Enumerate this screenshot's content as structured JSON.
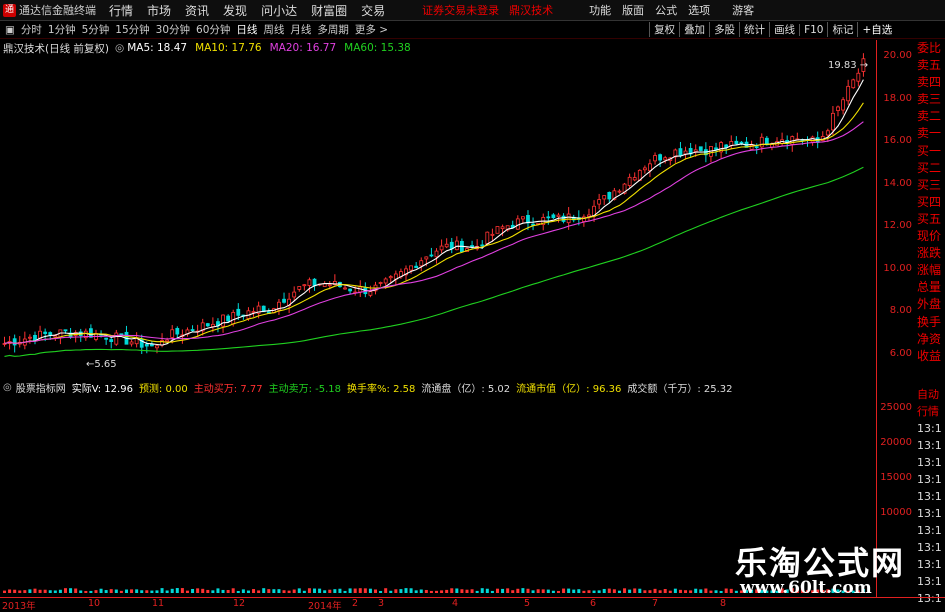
{
  "menubar": {
    "app_title": "通达信金融终端",
    "items": [
      "行情",
      "市场",
      "资讯",
      "发现",
      "问小达",
      "财富圈",
      "交易"
    ],
    "login_status": "证券交易未登录",
    "formula_name": "鼎汉技术",
    "right_items": [
      "功能",
      "版面",
      "公式",
      "选项"
    ],
    "guest": "游客"
  },
  "periods": [
    "分时",
    "1分钟",
    "5分钟",
    "15分钟",
    "30分钟",
    "60分钟",
    "日线",
    "周线",
    "月线",
    "多周期",
    "更多 >"
  ],
  "active_period": "日线",
  "tools": [
    "复权",
    "叠加",
    "多股",
    "统计",
    "画线",
    "F10",
    "标记",
    "+自选"
  ],
  "chart": {
    "title": "鼎汉技术(日线 前复权)",
    "ma": [
      {
        "label": "MA5: 18.47",
        "color": "#ffffff"
      },
      {
        "label": "MA10: 17.76",
        "color": "#f0e000"
      },
      {
        "label": "MA20: 16.77",
        "color": "#e040e0"
      },
      {
        "label": "MA60: 15.38",
        "color": "#20d020"
      }
    ],
    "high_label": "19.83",
    "low_label": "5.65"
  },
  "price_axis": [
    "20.00",
    "18.00",
    "16.00",
    "14.00",
    "12.00",
    "10.00",
    "8.00",
    "6.00"
  ],
  "vol_row": {
    "title": "股票指标网",
    "fields": [
      {
        "label": "实际V:",
        "value": "12.96",
        "color": "#ffffff"
      },
      {
        "label": "预测:",
        "value": "0.00",
        "color": "#f0e000"
      },
      {
        "label": "主动买万:",
        "value": "7.77",
        "color": "#ff3030"
      },
      {
        "label": "主动卖万:",
        "value": "-5.18",
        "color": "#20d020"
      },
      {
        "label": "换手率%:",
        "value": "2.58",
        "color": "#f0e000"
      },
      {
        "label": "流通盘（亿）:",
        "value": "5.02",
        "color": "#dddddd"
      },
      {
        "label": "流通市值（亿）:",
        "value": "96.36",
        "color": "#f0e000"
      },
      {
        "label": "成交额（千万）:",
        "value": "25.32",
        "color": "#dddddd"
      }
    ]
  },
  "vol_axis": [
    "25000",
    "20000",
    "15000",
    "10000"
  ],
  "side_labels": [
    "委比",
    "卖五",
    "卖四",
    "卖三",
    "卖二",
    "卖一",
    "买一",
    "买二",
    "买三",
    "买四",
    "买五",
    "现价",
    "涨跌",
    "涨幅",
    "总量",
    "外盘",
    "换手",
    "净资",
    "收益"
  ],
  "side_labels2": [
    "自动",
    "行情",
    "13:1",
    "13:1",
    "13:1",
    "13:1",
    "13:1",
    "13:1",
    "13:1",
    "13:1",
    "13:1",
    "13:1",
    "13:1"
  ],
  "date_axis": [
    "2013年",
    "10",
    "11",
    "12",
    "2014年",
    "2",
    "3",
    "4",
    "5",
    "6",
    "7",
    "8"
  ],
  "watermark": {
    "cn": "乐淘公式网",
    "url": "www.60lt.com"
  }
}
